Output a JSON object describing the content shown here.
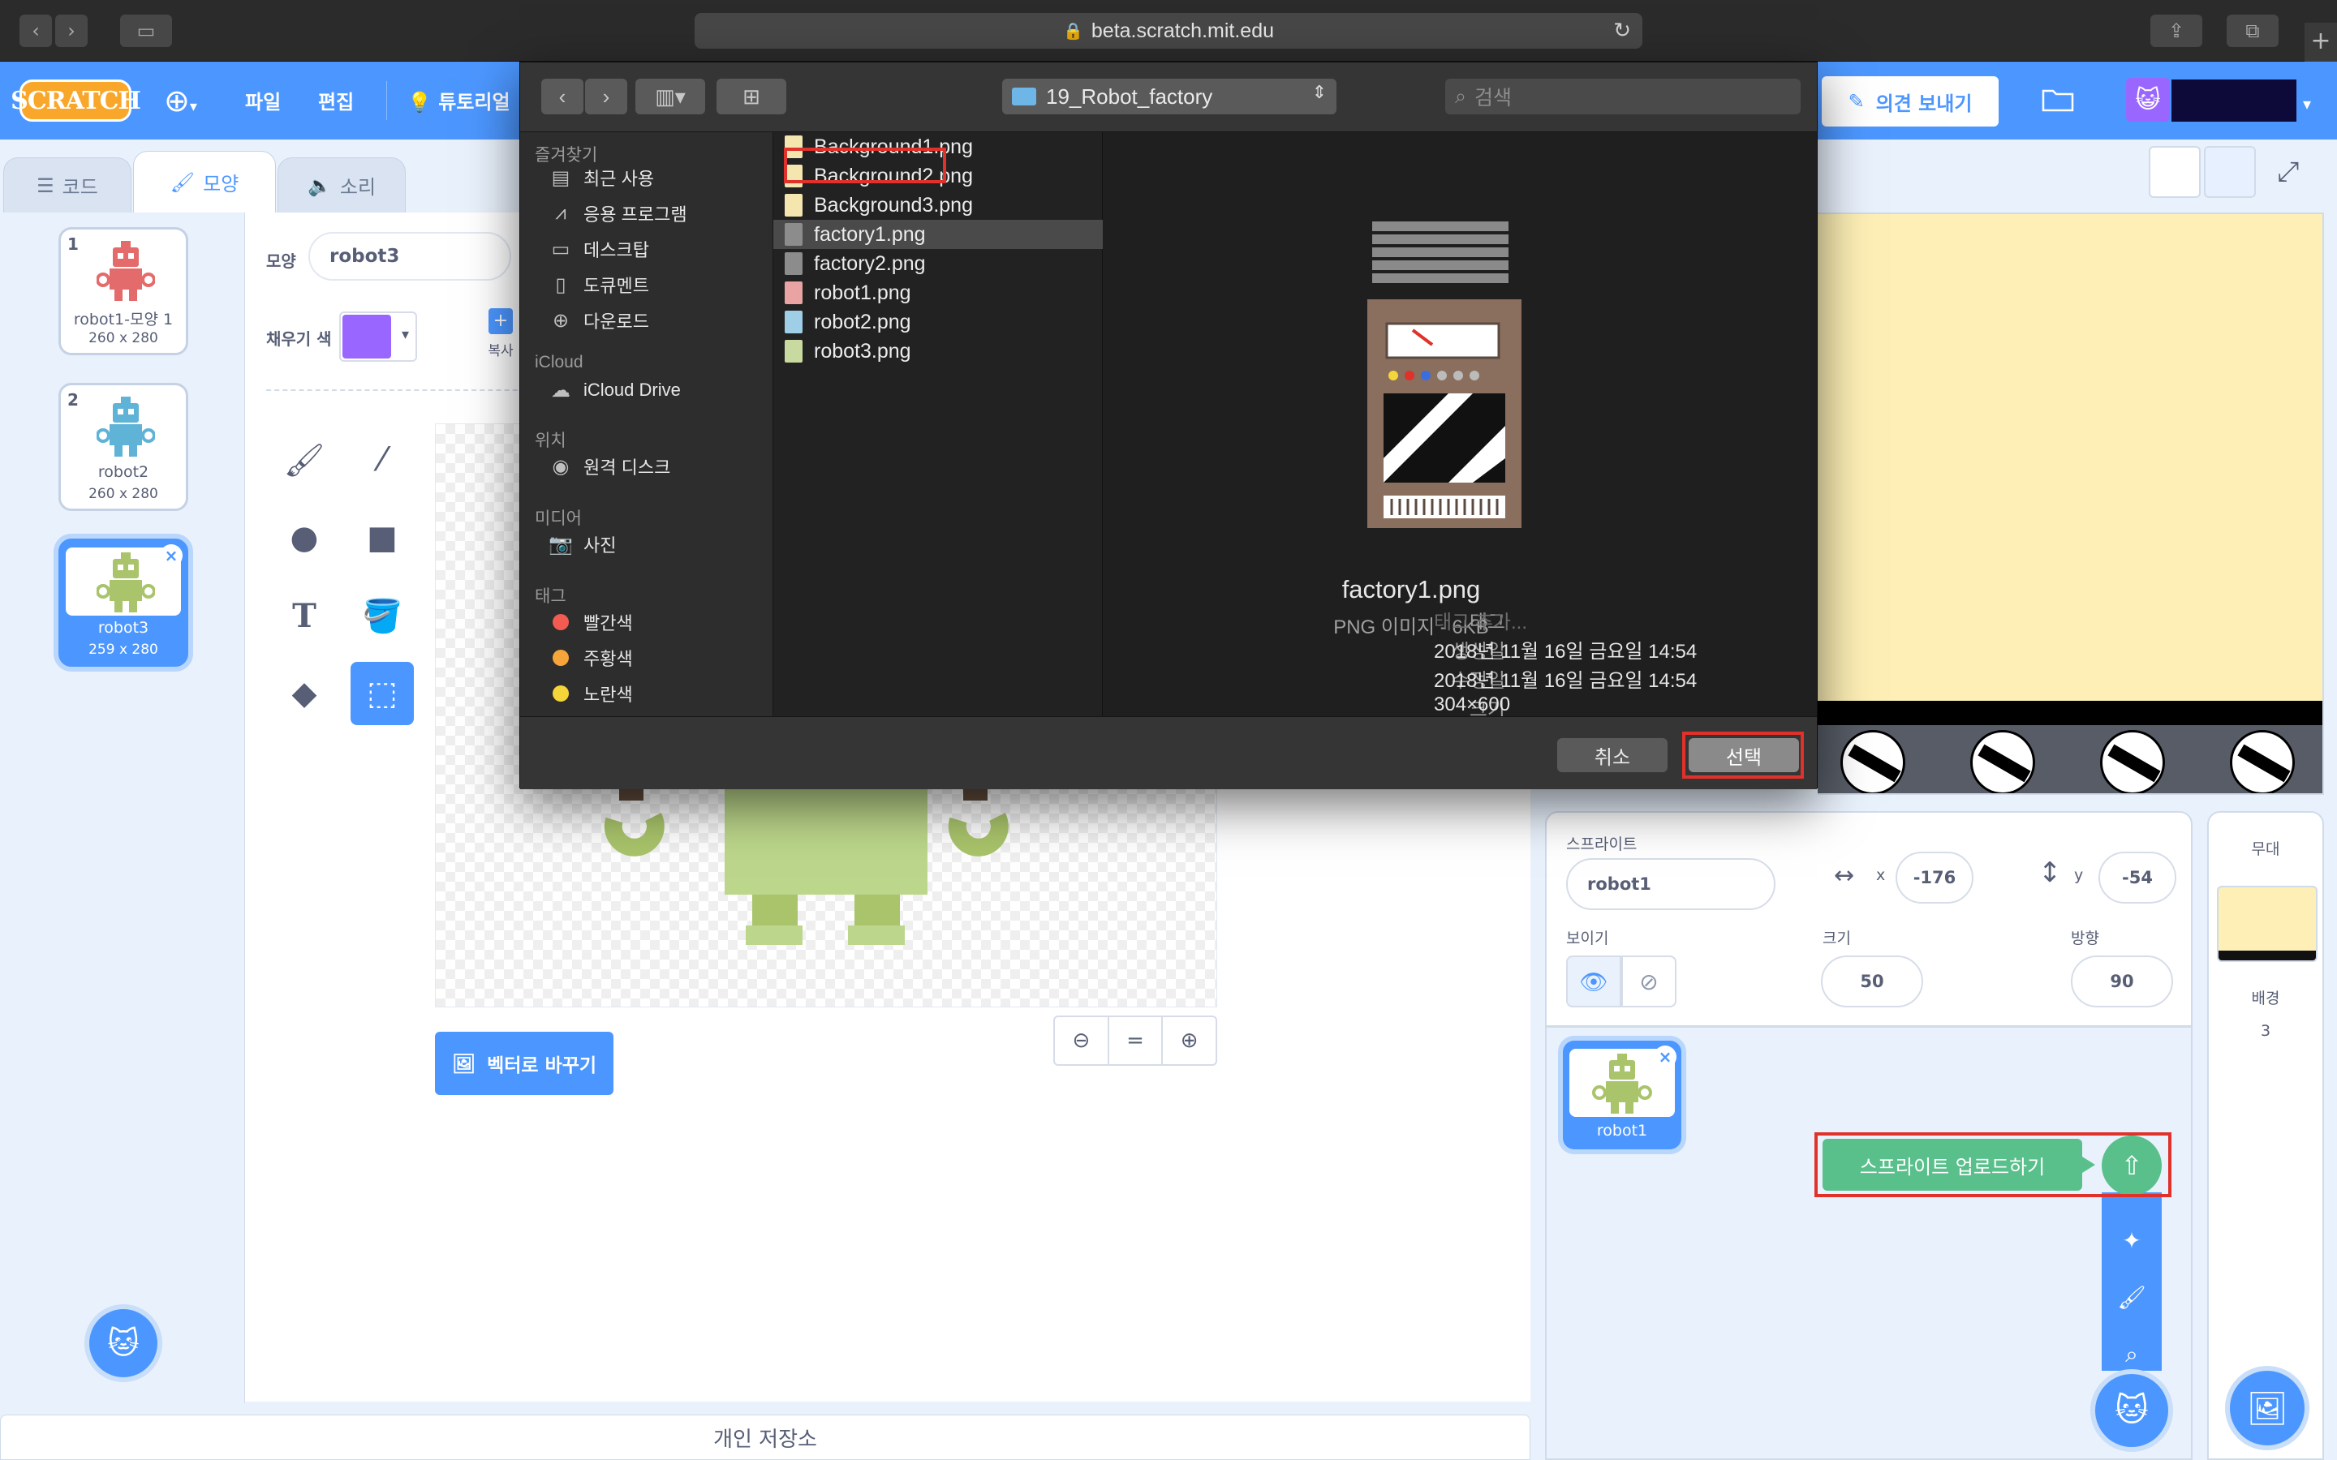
{
  "browser": {
    "url": "beta.scratch.mit.edu"
  },
  "menubar": {
    "logo": "SCRATCH",
    "file": "파일",
    "edit": "편집",
    "tutorials": "튜토리얼",
    "feedback": "의견 보내기"
  },
  "tabs": {
    "code": "코드",
    "costumes": "모양",
    "sounds": "소리"
  },
  "costumes": [
    {
      "num": "1",
      "name": "robot1-모양 1",
      "dims": "260 x 280",
      "color": "#e46b6b"
    },
    {
      "num": "2",
      "name": "robot2",
      "dims": "260 x 280",
      "color": "#5fb3d6"
    },
    {
      "num": "3",
      "name": "robot3",
      "dims": "259 x 280",
      "color": "#a9c46b"
    }
  ],
  "editor": {
    "costume_label": "모양",
    "costume_name": "robot3",
    "fill_label": "채우기 색",
    "fill_color": "#9966ff",
    "copy_label": "복사",
    "vector_button": "벡터로 바꾸기",
    "zoom_out": "−",
    "zoom_reset": "=",
    "zoom_in": "+"
  },
  "storage": "개인 저장소",
  "sprite_info": {
    "sprite_label": "스프라이트",
    "sprite_name": "robot1",
    "x_label": "x",
    "x_value": "-176",
    "y_label": "y",
    "y_value": "-54",
    "show_label": "보이기",
    "size_label": "크기",
    "size_value": "50",
    "direction_label": "방향",
    "direction_value": "90"
  },
  "sprite_list": [
    {
      "name": "robot1"
    }
  ],
  "upload_tooltip": "스프라이트 업로드하기",
  "stage_panel": {
    "title": "무대",
    "backdrops_label": "배경",
    "backdrops_count": "3"
  },
  "dialog": {
    "folder": "19_Robot_factory",
    "search_placeholder": "검색",
    "sidebar": {
      "favorites_head": "즐겨찾기",
      "favorites": [
        {
          "label": "최근 사용",
          "icon": "recents-icon"
        },
        {
          "label": "응용 프로그램",
          "icon": "applications-icon"
        },
        {
          "label": "데스크탑",
          "icon": "desktop-icon"
        },
        {
          "label": "도큐멘트",
          "icon": "documents-icon"
        },
        {
          "label": "다운로드",
          "icon": "downloads-icon"
        }
      ],
      "icloud_head": "iCloud",
      "icloud_drive": "iCloud Drive",
      "locations_head": "위치",
      "remote_disc": "원격 디스크",
      "media_head": "미디어",
      "photos": "사진",
      "tags_head": "태그",
      "tags": [
        {
          "label": "빨간색",
          "color": "#f25b52"
        },
        {
          "label": "주황색",
          "color": "#f5a53a"
        },
        {
          "label": "노란색",
          "color": "#f4d63a"
        }
      ]
    },
    "files": [
      {
        "name": "Background1.png",
        "kind": "bg"
      },
      {
        "name": "Background2.png",
        "kind": "bg"
      },
      {
        "name": "Background3.png",
        "kind": "bg"
      },
      {
        "name": "factory1.png",
        "kind": "factory"
      },
      {
        "name": "factory2.png",
        "kind": "factory"
      },
      {
        "name": "robot1.png",
        "kind": "robot-red"
      },
      {
        "name": "robot2.png",
        "kind": "robot-blue"
      },
      {
        "name": "robot3.png",
        "kind": "robot-green"
      }
    ],
    "selected_file": "factory1.png",
    "preview": {
      "name": "factory1.png",
      "subtitle": "PNG 이미지 - 6KB",
      "tags_key": "태그",
      "tags_value": "태그 추가...",
      "created_key": "생성일",
      "created_value": "2018년 11월 16일 금요일 14:54",
      "modified_key": "수정일",
      "modified_value": "2018년 11월 16일 금요일 14:54",
      "size_key": "크기",
      "size_value": "304×600"
    },
    "cancel": "취소",
    "choose": "선택"
  }
}
